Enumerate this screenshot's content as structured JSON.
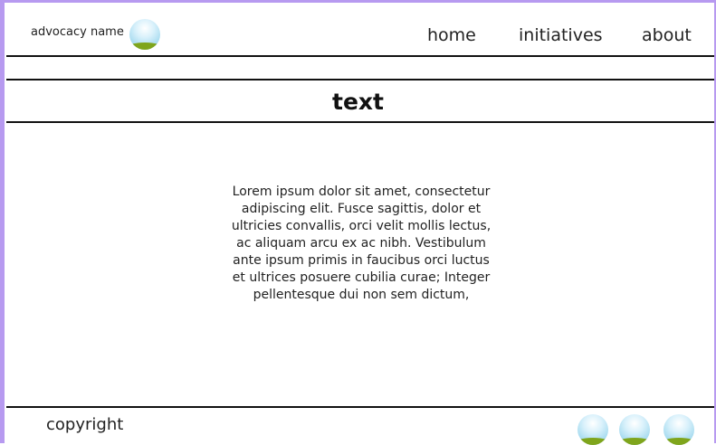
{
  "header": {
    "brand": "advocacy name",
    "logo_icon": "landscape-bubble-icon",
    "nav": [
      {
        "label": "home"
      },
      {
        "label": "initiatives"
      },
      {
        "label": "about"
      }
    ]
  },
  "main": {
    "title": "text",
    "body": "Lorem ipsum dolor sit amet, consectetur adipiscing elit. Fusce sagittis, dolor et ultricies convallis, orci velit mollis lectus, ac aliquam arcu ex ac nibh. Vestibulum ante ipsum primis in faucibus orci luctus et ultrices posuere cubilia curae; Integer pellentesque dui non sem dictum,"
  },
  "footer": {
    "copyright": "copyright",
    "social_icons": [
      "landscape-bubble-icon",
      "landscape-bubble-icon",
      "landscape-bubble-icon"
    ]
  },
  "colors": {
    "frame_border": "#b79af0",
    "rule": "#111111",
    "bubble_sky": "#a9dcf0",
    "bubble_grass": "#7fa51c"
  }
}
